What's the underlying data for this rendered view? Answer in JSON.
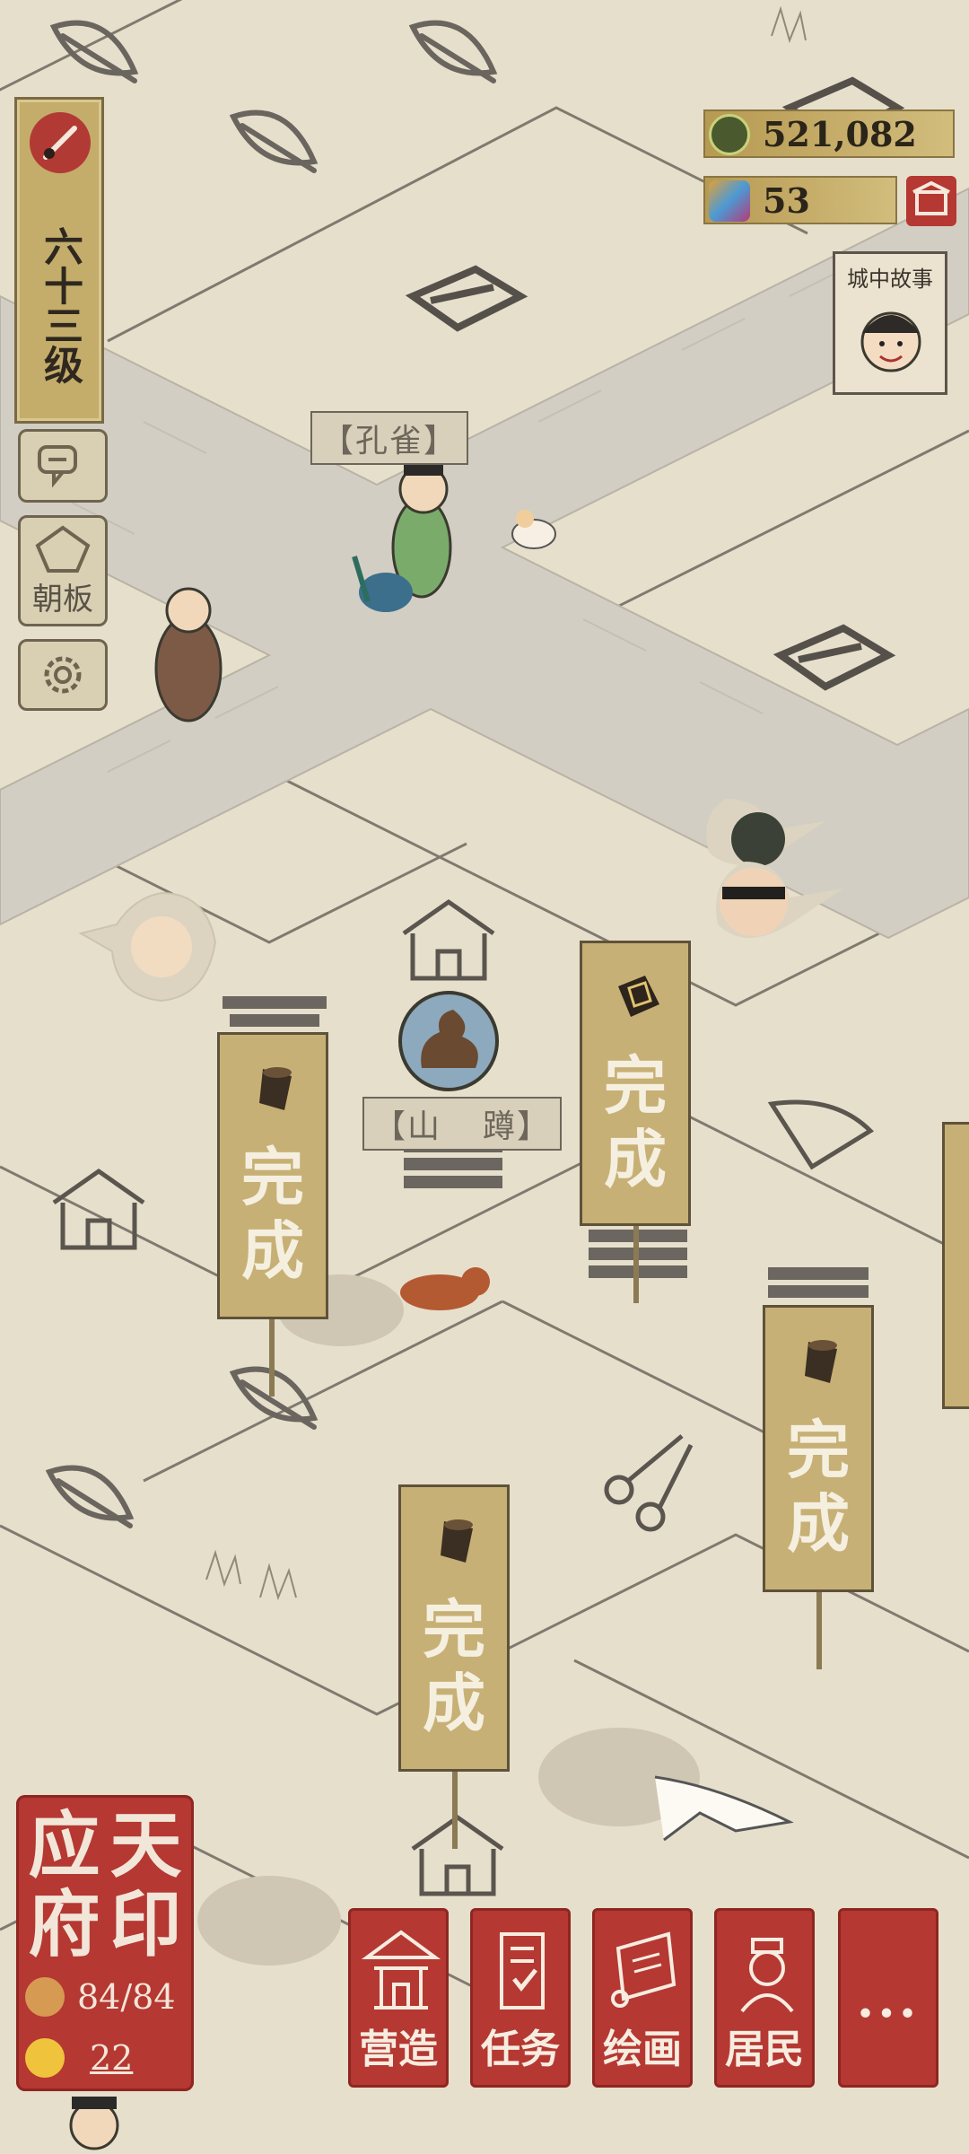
{
  "level": {
    "label": "六十三级"
  },
  "side_buttons": {
    "chat_icon": "chat-bubbles-icon",
    "board_label": "朝板",
    "settings_icon": "gear-icon"
  },
  "currency": {
    "coins": "521,082",
    "gems": "53"
  },
  "story": {
    "label": "城中故事"
  },
  "map": {
    "npc_peacock_name": "【孔雀】",
    "npc_shanjiao_name": "【山",
    "npc_shanjiao_name_end": "蹲】"
  },
  "banners": [
    {
      "label": "完成",
      "icon": "wood-log-icon"
    },
    {
      "label": "完成",
      "icon": "plaque-icon"
    },
    {
      "label": "完成",
      "icon": "wood-log-icon"
    },
    {
      "label": "完成",
      "icon": "wood-log-icon"
    }
  ],
  "seal": {
    "title_chars": [
      "应",
      "天",
      "府",
      "印"
    ],
    "population": "84/84",
    "happiness": "22"
  },
  "bottom_nav": {
    "build": "营造",
    "tasks": "任务",
    "painting": "绘画",
    "residents": "居民",
    "more": "..."
  },
  "colors": {
    "seal_red": "#b53832",
    "gold": "#c7b075",
    "paper": "#e6dfcb"
  }
}
